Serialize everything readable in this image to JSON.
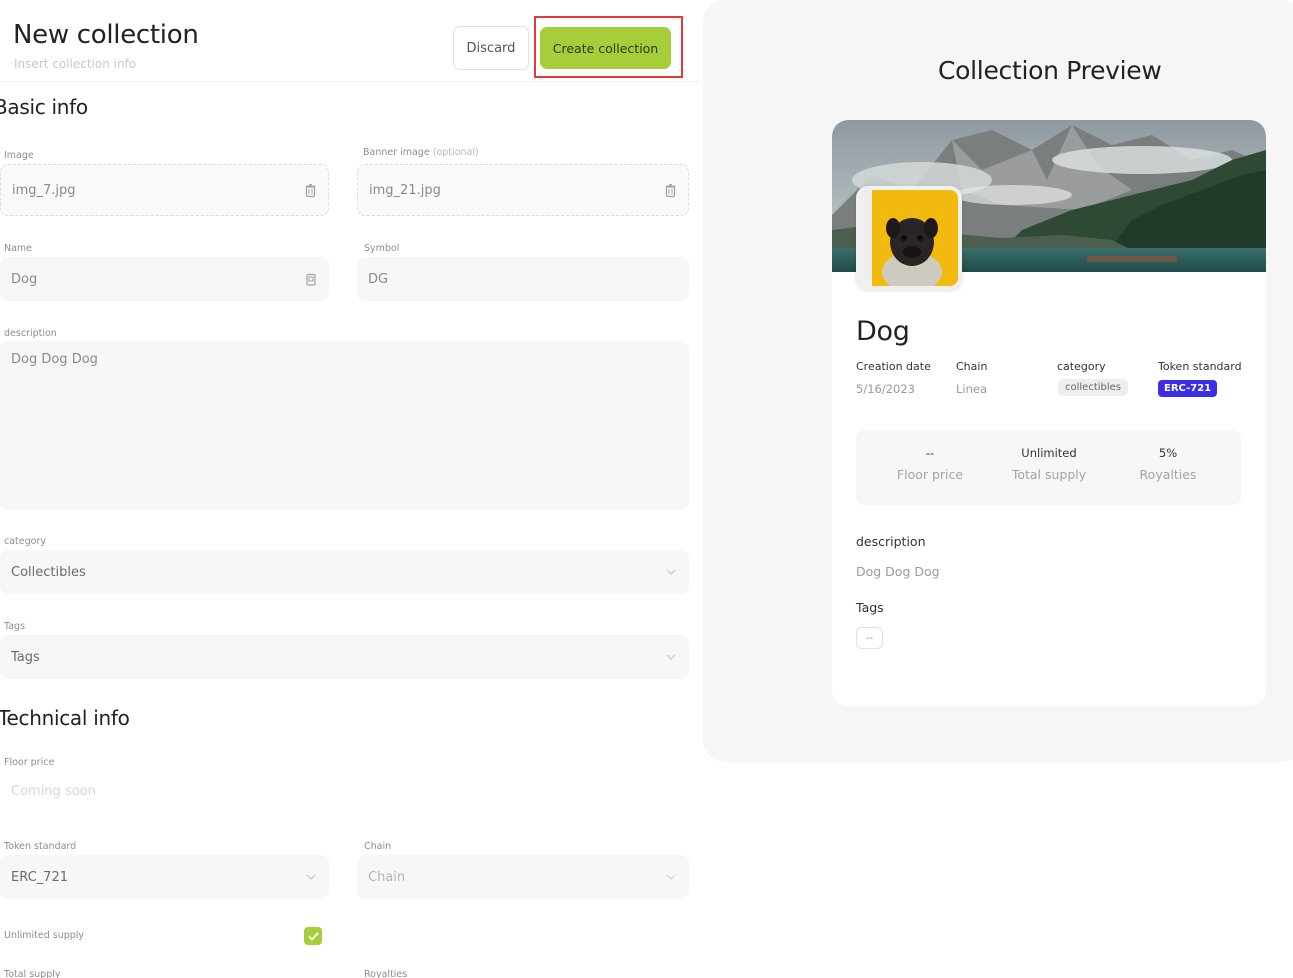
{
  "header": {
    "title": "New collection",
    "subtitle": "Insert collection info",
    "discard_label": "Discard",
    "create_label": "Create collection"
  },
  "basic_info": {
    "title": "Basic info",
    "image": {
      "label": "Image",
      "value": "img_7.jpg",
      "icon": "trash-icon"
    },
    "banner": {
      "label": "Banner image",
      "optional": "(optional)",
      "value": "img_21.jpg",
      "icon": "trash-icon"
    },
    "name": {
      "label": "Name",
      "value": "Dog"
    },
    "symbol": {
      "label": "Symbol",
      "value": "DG"
    },
    "description": {
      "label": "description",
      "value": "Dog Dog Dog"
    },
    "category": {
      "label": "category",
      "value": "Collectibles"
    },
    "tags": {
      "label": "Tags",
      "value": "Tags"
    }
  },
  "technical_info": {
    "title": "Technical info",
    "floor_price": {
      "label": "Floor price",
      "placeholder": "Coming soon"
    },
    "token_standard": {
      "label": "Token standard",
      "value": "ERC_721"
    },
    "chain": {
      "label": "Chain",
      "value": "Chain"
    },
    "unlimited_supply": {
      "label": "Unlimited supply",
      "checked": true
    },
    "total_supply": {
      "label": "Total supply"
    },
    "royalties": {
      "label": "Royalties"
    }
  },
  "preview": {
    "title": "Collection Preview",
    "name": "Dog",
    "creation_date_label": "Creation date",
    "creation_date": "5/16/2023",
    "chain_label": "Chain",
    "chain": "Linea",
    "category_label": "category",
    "category": "collectibles",
    "token_label": "Token standard",
    "token": "ERC-721",
    "stats": [
      {
        "value": "--",
        "label": "Floor price"
      },
      {
        "value": "Unlimited",
        "label": "Total supply"
      },
      {
        "value": "5%",
        "label": "Royalties"
      }
    ],
    "description_label": "description",
    "description": "Dog Dog Dog",
    "tags_label": "Tags",
    "tag": "--"
  },
  "colors": {
    "accent": "#a6cd3a",
    "token_badge": "#3b2ee6",
    "highlight": "#e53935"
  }
}
